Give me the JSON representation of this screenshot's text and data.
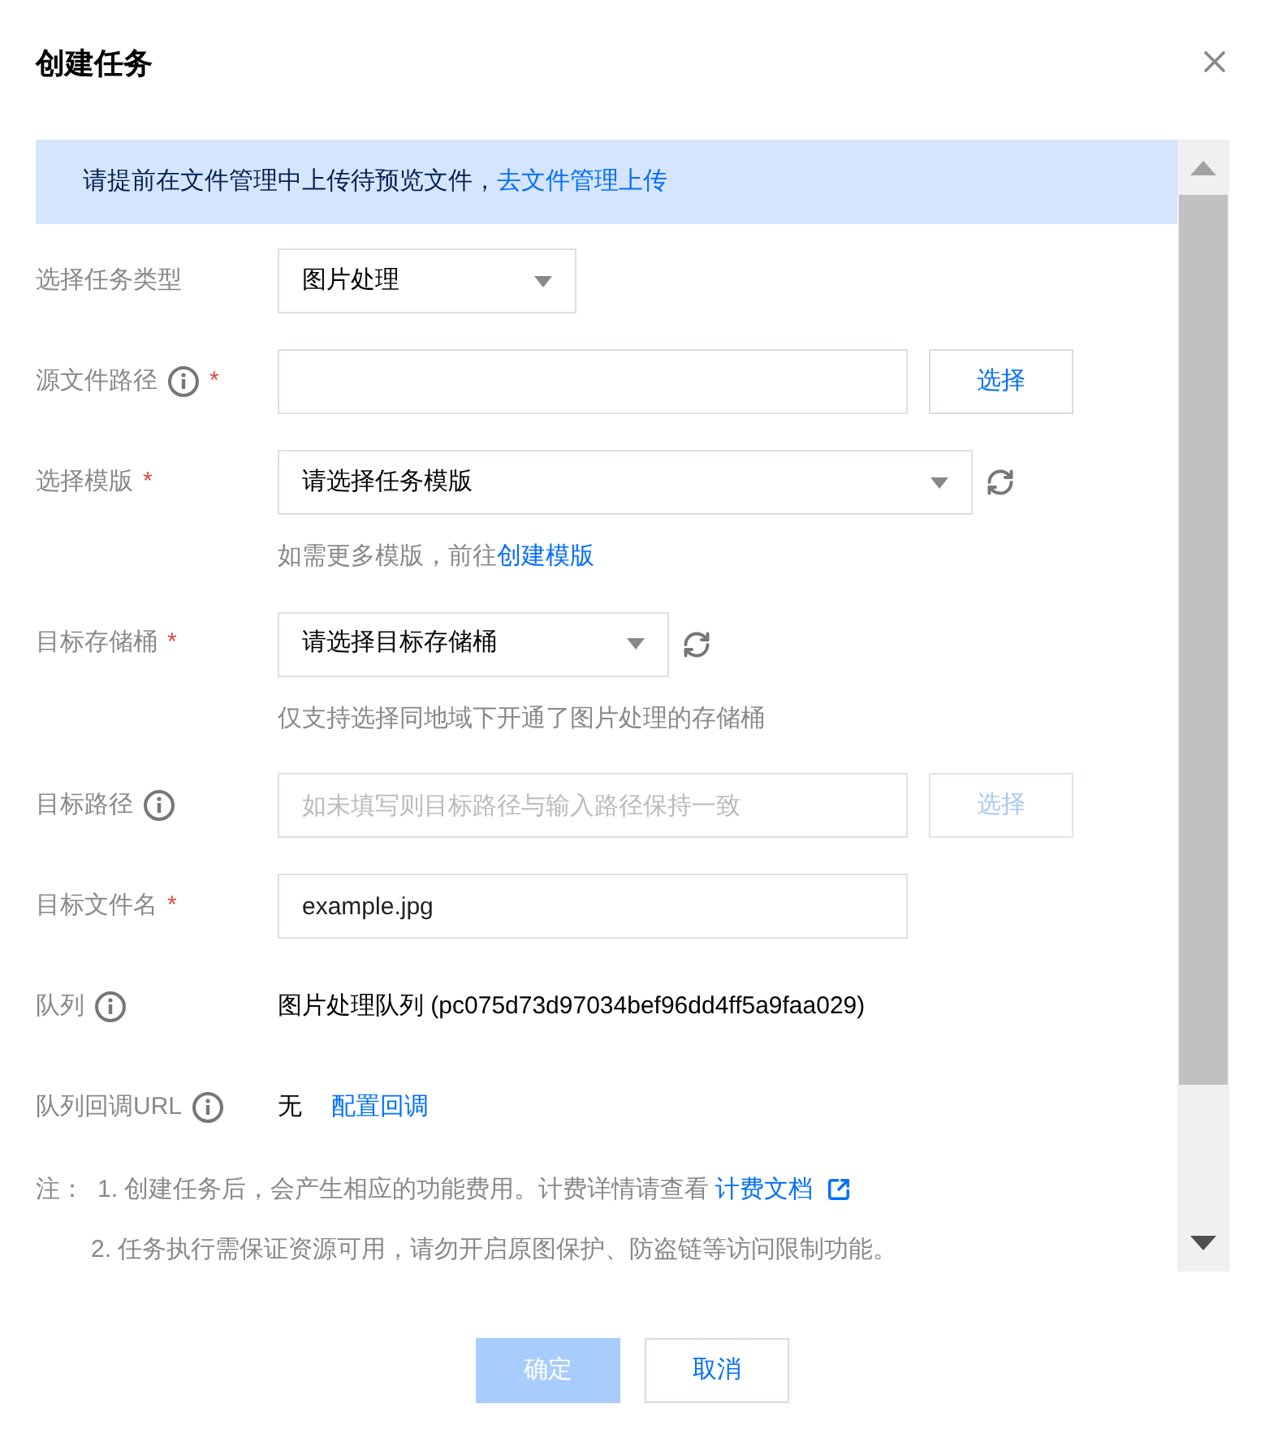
{
  "dialog": {
    "title": "创建任务"
  },
  "alert": {
    "text": "请提前在文件管理中上传待预览文件，",
    "link": "去文件管理上传"
  },
  "fields": [
    {
      "label": "选择任务类型",
      "kind": "select",
      "value": "图片处理"
    },
    {
      "label": "源文件路径",
      "info": true,
      "required_mark": "*",
      "kind": "input",
      "button": {
        "label": "选择",
        "disabled": false
      }
    },
    {
      "label": "选择模版",
      "required_mark": "*",
      "kind": "select",
      "value": "请选择任务模版",
      "refresh": true,
      "hint": "如需更多模版，前往",
      "hint_link": "创建模版"
    },
    {
      "label": "目标存储桶",
      "required_mark": "*",
      "kind": "select",
      "value": "请选择目标存储桶",
      "refresh": true,
      "hint": "仅支持选择同地域下开通了图片处理的存储桶"
    },
    {
      "label": "目标路径",
      "info": true,
      "kind": "input",
      "placeholder": "如未填写则目标路径与输入路径保持一致",
      "button": {
        "label": "选择",
        "disabled": true
      }
    },
    {
      "label": "目标文件名",
      "required_mark": "*",
      "kind": "input",
      "value": "example.jpg"
    },
    {
      "label": "队列",
      "info": true,
      "kind": "text",
      "value": "图片处理队列 (pc075d73d97034bef96dd4ff5a9faa029)"
    },
    {
      "label": "队列回调URL",
      "info": true,
      "kind": "text",
      "value": "无",
      "link": "配置回调"
    }
  ],
  "notes": {
    "label": "注：",
    "items": [
      {
        "text": "1. 创建任务后，会产生相应的功能费用。计费详情请查看 ",
        "link": "计费文档"
      },
      {
        "text": "2. 任务执行需保证资源可用，请勿开启原图保护、防盗链等访问限制功能。"
      }
    ]
  },
  "buttons": [
    {
      "label": "确定",
      "kind": "primary",
      "disabled": true
    },
    {
      "label": "取消",
      "kind": "secondary",
      "disabled": false
    }
  ]
}
